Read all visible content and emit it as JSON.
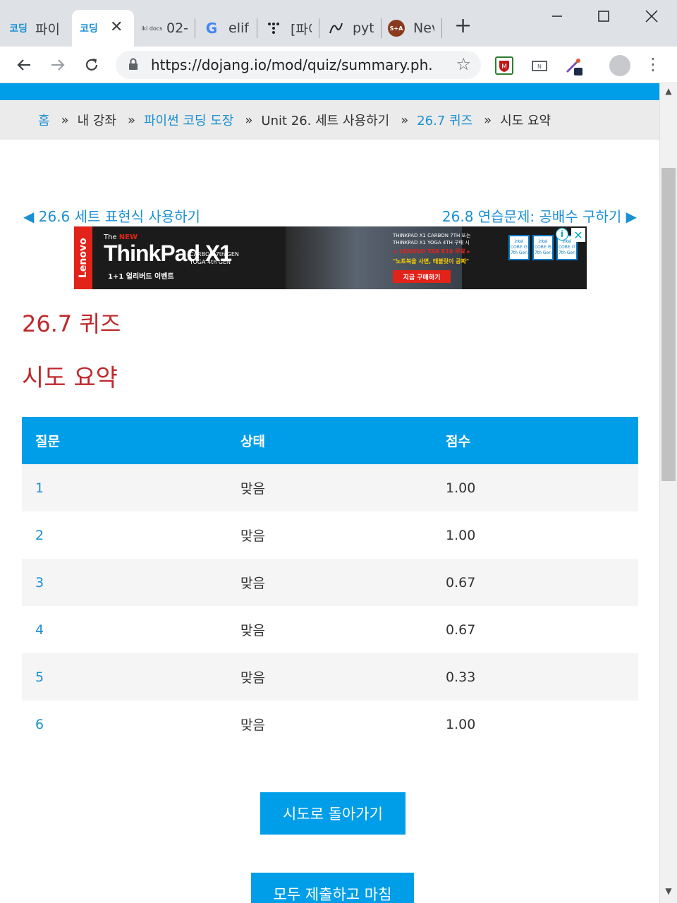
{
  "browser": {
    "tabs": [
      {
        "title": "파이",
        "favicon": "코딩"
      },
      {
        "title": "",
        "favicon": "코딩",
        "active": true
      },
      {
        "title": "02-",
        "favicon": "wiki docs"
      },
      {
        "title": "elif",
        "favicon": "G"
      },
      {
        "title": "[파이",
        "favicon": "dots"
      },
      {
        "title": "pyt",
        "favicon": "wave"
      },
      {
        "title": "Nev",
        "favicon": "S+A"
      }
    ],
    "new_tab": "+",
    "url": "https://dojang.io/mod/quiz/summary.ph..."
  },
  "breadcrumb": {
    "home": "홈",
    "sep": "»",
    "my_courses": "내 강좌",
    "course": "파이썬 코딩 도장",
    "unit": "Unit 26. 세트 사용하기",
    "quiz": "26.7 퀴즈",
    "current": "시도 요약"
  },
  "nav": {
    "prev": "◀ 26.6 세트 표현식 사용하기",
    "next": "26.8 연습문제: 공배수 구하기 ▶"
  },
  "ad": {
    "brand": "Lenovo",
    "the_new": "The",
    "new_word": "NEW",
    "product": "ThinkPad X1",
    "gen_line1": "CARBON 7th GEN",
    "gen_line2": "YOGA 4th GEN",
    "event": "1+1 얼리버드 이벤트",
    "right_line1": "THINKPAD X1 CARBON 7TH 또는",
    "right_line2": "THINKPAD X1 YOGA 4TH 구매 시",
    "right_offer": "+ LENOVO TAB E10 무료 ▸",
    "right_slogan": "\"노트북을 사면, 태블릿이 공짜\"",
    "buy_button": "지금 구매하기",
    "chips": [
      "intel CORE i3 7th Gen",
      "intel CORE i5 7th Gen",
      "intel CORE i7 7th Gen"
    ],
    "info": "i",
    "close": "✕"
  },
  "page": {
    "quiz_title": "26.7 퀴즈",
    "summary_title": "시도 요약"
  },
  "table": {
    "headers": [
      "질문",
      "상태",
      "점수"
    ],
    "rows": [
      {
        "q": "1",
        "status": "맞음",
        "score": "1.00"
      },
      {
        "q": "2",
        "status": "맞음",
        "score": "1.00"
      },
      {
        "q": "3",
        "status": "맞음",
        "score": "0.67"
      },
      {
        "q": "4",
        "status": "맞음",
        "score": "0.67"
      },
      {
        "q": "5",
        "status": "맞음",
        "score": "0.33"
      },
      {
        "q": "6",
        "status": "맞음",
        "score": "1.00"
      }
    ]
  },
  "buttons": {
    "return_attempt": "시도로 돌아가기",
    "submit_all": "모두 제출하고 마침"
  },
  "colors": {
    "accent_blue": "#009ee8",
    "link_blue": "#1a8fd4",
    "heading_red": "#c0282d",
    "breadcrumb_bg": "#ebebeb"
  }
}
